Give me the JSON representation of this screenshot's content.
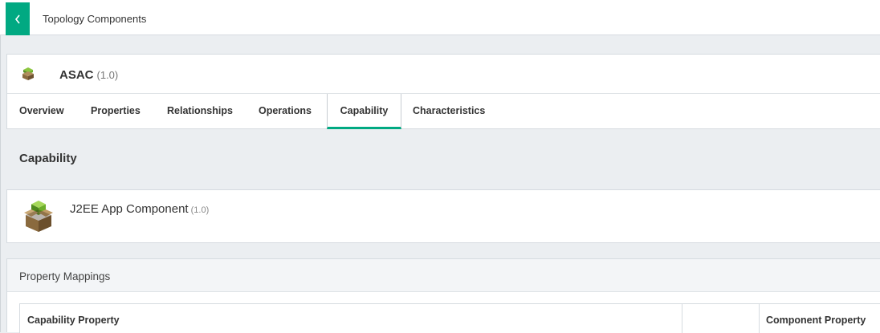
{
  "topbar": {
    "title": "Topology Components",
    "back_icon": "chevron-left-icon"
  },
  "component": {
    "name": "ASAC",
    "version": "(1.0)",
    "icon": "component-box-icon"
  },
  "tabs": [
    {
      "label": "Overview",
      "active": false
    },
    {
      "label": "Properties",
      "active": false
    },
    {
      "label": "Relationships",
      "active": false
    },
    {
      "label": "Operations",
      "active": false
    },
    {
      "label": "Capability",
      "active": true
    },
    {
      "label": "Characteristics",
      "active": false
    }
  ],
  "capability": {
    "heading": "Capability",
    "item_name": "J2EE App Component",
    "item_version": "(1.0)",
    "icon": "component-box-icon"
  },
  "property_mappings": {
    "title": "Property Mappings",
    "columns": [
      "Capability Property",
      "",
      "Component Property"
    ]
  },
  "colors": {
    "accent": "#01a982",
    "background": "#ebeef1",
    "card": "#ffffff",
    "border": "#d6dbe0"
  }
}
